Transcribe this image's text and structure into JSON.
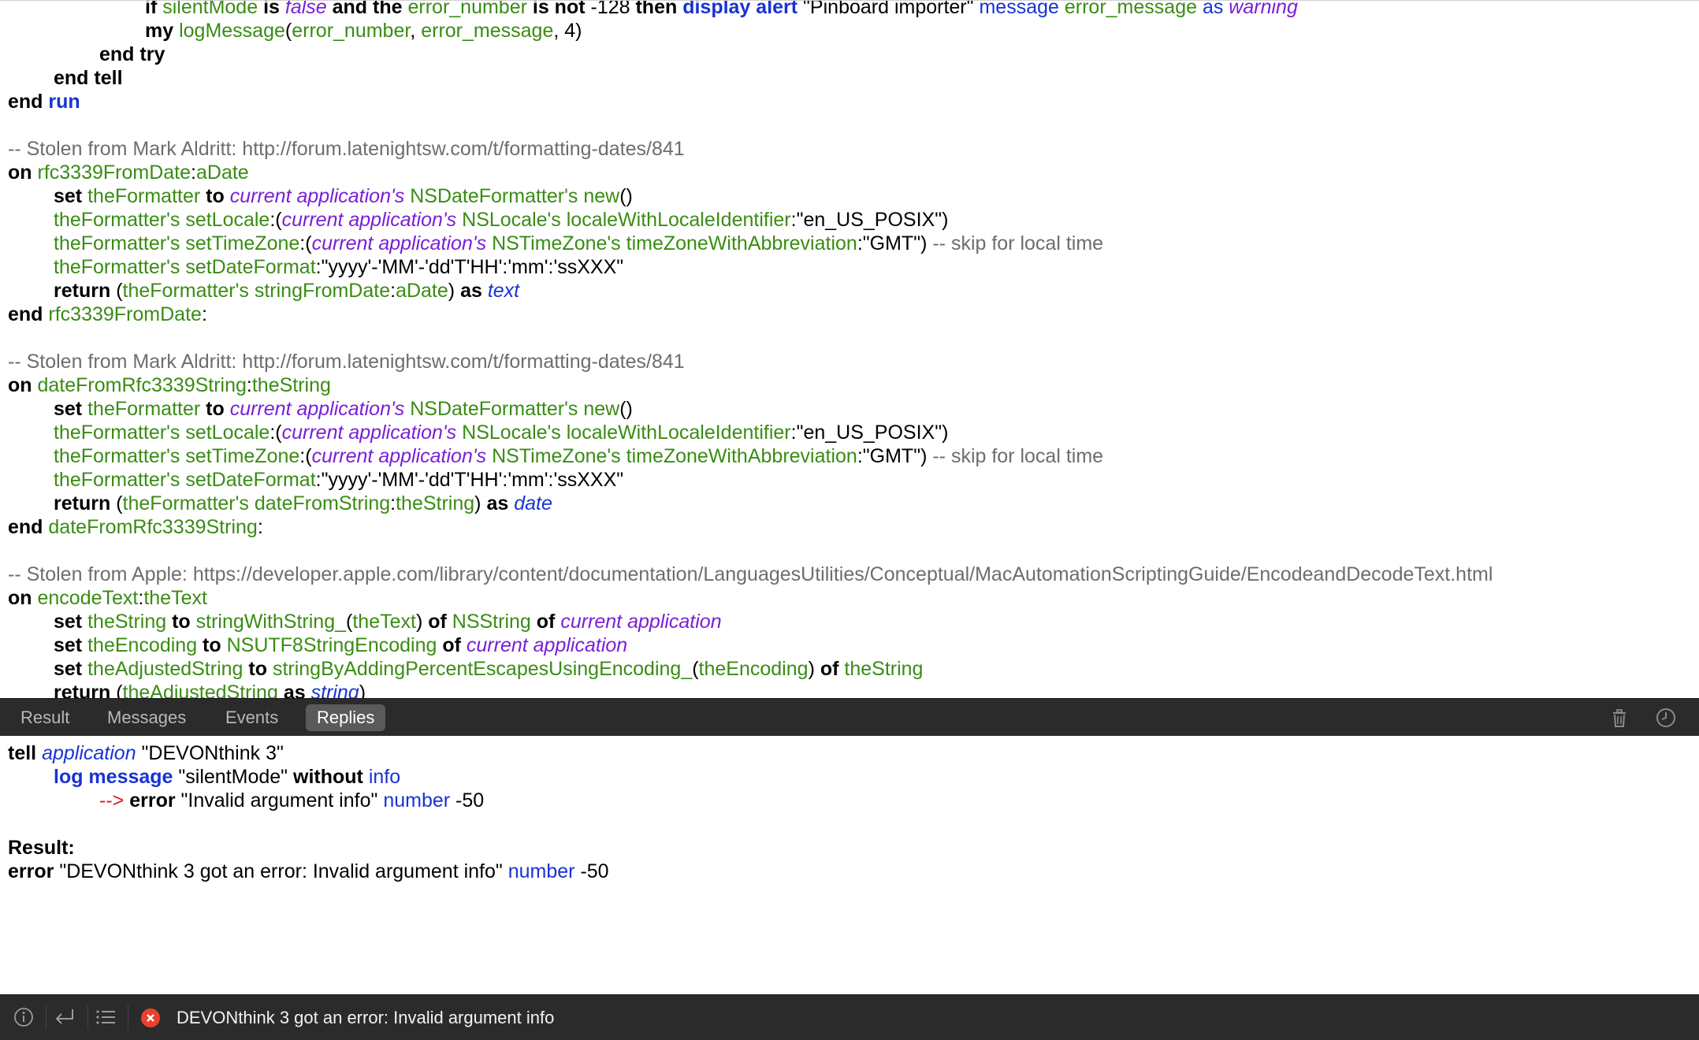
{
  "editor": {
    "l1": {
      "t0": "if ",
      "t1": "silentMode",
      "t2": " is ",
      "t3": "false",
      "t4": " and the ",
      "t5": "error_number",
      "t6": " is not ",
      "t7": "-128 ",
      "t8": "then ",
      "t9": "display alert",
      "t10": " \"Pinboard importer\" ",
      "t11": "message",
      "t12": " error_message ",
      "t13": "as",
      "t14": " warning"
    },
    "l2": {
      "t0": "my ",
      "t1": "logMessage",
      "t2": "(",
      "t3": "error_number",
      "t4": ", ",
      "t5": "error_message",
      "t6": ", 4)"
    },
    "l3": {
      "t0": "end try"
    },
    "l4": {
      "t0": "end tell"
    },
    "l5": {
      "t0": "end ",
      "t1": "run"
    },
    "c1": "-- Stolen from Mark Aldritt: http://forum.latenightsw.com/t/formatting-dates/841",
    "h1": {
      "t0": "on ",
      "t1": "rfc3339FromDate",
      "t2": ":",
      "t3": "aDate"
    },
    "a1": {
      "t0": "set ",
      "t1": "theFormatter",
      "t2": " to ",
      "t3": "current application's",
      "t4": " NSDateFormatter's new",
      "t5": "()"
    },
    "a2": {
      "t0": "theFormatter's setLocale",
      "t1": ":(",
      "t2": "current application's",
      "t3": " NSLocale's localeWithLocaleIdentifier",
      "t4": ":\"en_US_POSIX\")"
    },
    "a3": {
      "t0": "theFormatter's setTimeZone",
      "t1": ":(",
      "t2": "current application's",
      "t3": " NSTimeZone's timeZoneWithAbbreviation",
      "t4": ":\"GMT\") ",
      "t5": "-- skip for local time"
    },
    "a4": {
      "t0": "theFormatter's setDateFormat",
      "t1": ":\"yyyy'-'MM'-'dd'T'HH':'mm':'ssXXX\""
    },
    "a5": {
      "t0": "return ",
      "t1": "(",
      "t2": "theFormatter's stringFromDate",
      "t3": ":",
      "t4": "aDate",
      "t5": ") ",
      "t6": "as ",
      "t7": "text"
    },
    "e1": {
      "t0": "end ",
      "t1": "rfc3339FromDate",
      "t2": ":"
    },
    "c2": "-- Stolen from Mark Aldritt: http://forum.latenightsw.com/t/formatting-dates/841",
    "h2": {
      "t0": "on ",
      "t1": "dateFromRfc3339String",
      "t2": ":",
      "t3": "theString"
    },
    "b1": {
      "t0": "set ",
      "t1": "theFormatter",
      "t2": " to ",
      "t3": "current application's",
      "t4": " NSDateFormatter's new",
      "t5": "()"
    },
    "b2": {
      "t0": "theFormatter's setLocale",
      "t1": ":(",
      "t2": "current application's",
      "t3": " NSLocale's localeWithLocaleIdentifier",
      "t4": ":\"en_US_POSIX\")"
    },
    "b3": {
      "t0": "theFormatter's setTimeZone",
      "t1": ":(",
      "t2": "current application's",
      "t3": " NSTimeZone's timeZoneWithAbbreviation",
      "t4": ":\"GMT\") ",
      "t5": "-- skip for local time"
    },
    "b4": {
      "t0": "theFormatter's setDateFormat",
      "t1": ":\"yyyy'-'MM'-'dd'T'HH':'mm':'ssXXX\""
    },
    "b5": {
      "t0": "return ",
      "t1": "(",
      "t2": "theFormatter's dateFromString",
      "t3": ":",
      "t4": "theString",
      "t5": ") ",
      "t6": "as ",
      "t7": "date"
    },
    "e2": {
      "t0": "end ",
      "t1": "dateFromRfc3339String",
      "t2": ":"
    },
    "c3": "-- Stolen from Apple: https://developer.apple.com/library/content/documentation/LanguagesUtilities/Conceptual/MacAutomationScriptingGuide/EncodeandDecodeText.html",
    "h3": {
      "t0": "on ",
      "t1": "encodeText",
      "t2": ":",
      "t3": "theText"
    },
    "d1": {
      "t0": "set ",
      "t1": "theString",
      "t2": " to ",
      "t3": "stringWithString_",
      "t4": "(",
      "t5": "theText",
      "t6": ") ",
      "t7": "of ",
      "t8": "NSString ",
      "t9": "of ",
      "t10": "current application"
    },
    "d2": {
      "t0": "set ",
      "t1": "theEncoding",
      "t2": " to ",
      "t3": "NSUTF8StringEncoding ",
      "t4": "of ",
      "t5": "current application"
    },
    "d3": {
      "t0": "set ",
      "t1": "theAdjustedString",
      "t2": " to ",
      "t3": "stringByAddingPercentEscapesUsingEncoding_",
      "t4": "(",
      "t5": "theEncoding",
      "t6": ") ",
      "t7": "of ",
      "t8": "theString"
    },
    "d4": {
      "t0": "return ",
      "t1": "(",
      "t2": "theAdjustedString",
      "t3": " as ",
      "t4": "string",
      "t5": ")"
    }
  },
  "tabs": [
    "Result",
    "Messages",
    "Events",
    "Replies"
  ],
  "active_tab": "Replies",
  "toolbar_icons": [
    "trash-icon",
    "clock-icon"
  ],
  "output": {
    "o1": {
      "t0": "tell ",
      "t1": "application",
      "t2": " \"DEVONthink 3\""
    },
    "o2": {
      "t0": "log message",
      "t1": " \"silentMode\" ",
      "t2": "without ",
      "t3": "info"
    },
    "o3": {
      "t0": "--> ",
      "t1": "error",
      "t2": " \"Invalid argument info\" ",
      "t3": "number",
      "t4": " -50"
    },
    "result_label": "Result:",
    "o4": {
      "t0": "error",
      "t1": " \"DEVONthink 3 got an error: Invalid argument info\" ",
      "t2": "number",
      "t3": " -50"
    }
  },
  "statusbar": {
    "icons": [
      "info-icon",
      "return-arrow-icon",
      "list-icon",
      "error-icon"
    ],
    "message": "DEVONthink 3 got an error: Invalid argument info"
  },
  "colors": {
    "keyword": "#000000",
    "identifier": "#3a8c14",
    "application": "#7a1fd6",
    "applescript_term": "#1733d6",
    "comment": "#6d6d6d",
    "error": "#e01b1b",
    "bar_background": "#2b2b2b"
  }
}
